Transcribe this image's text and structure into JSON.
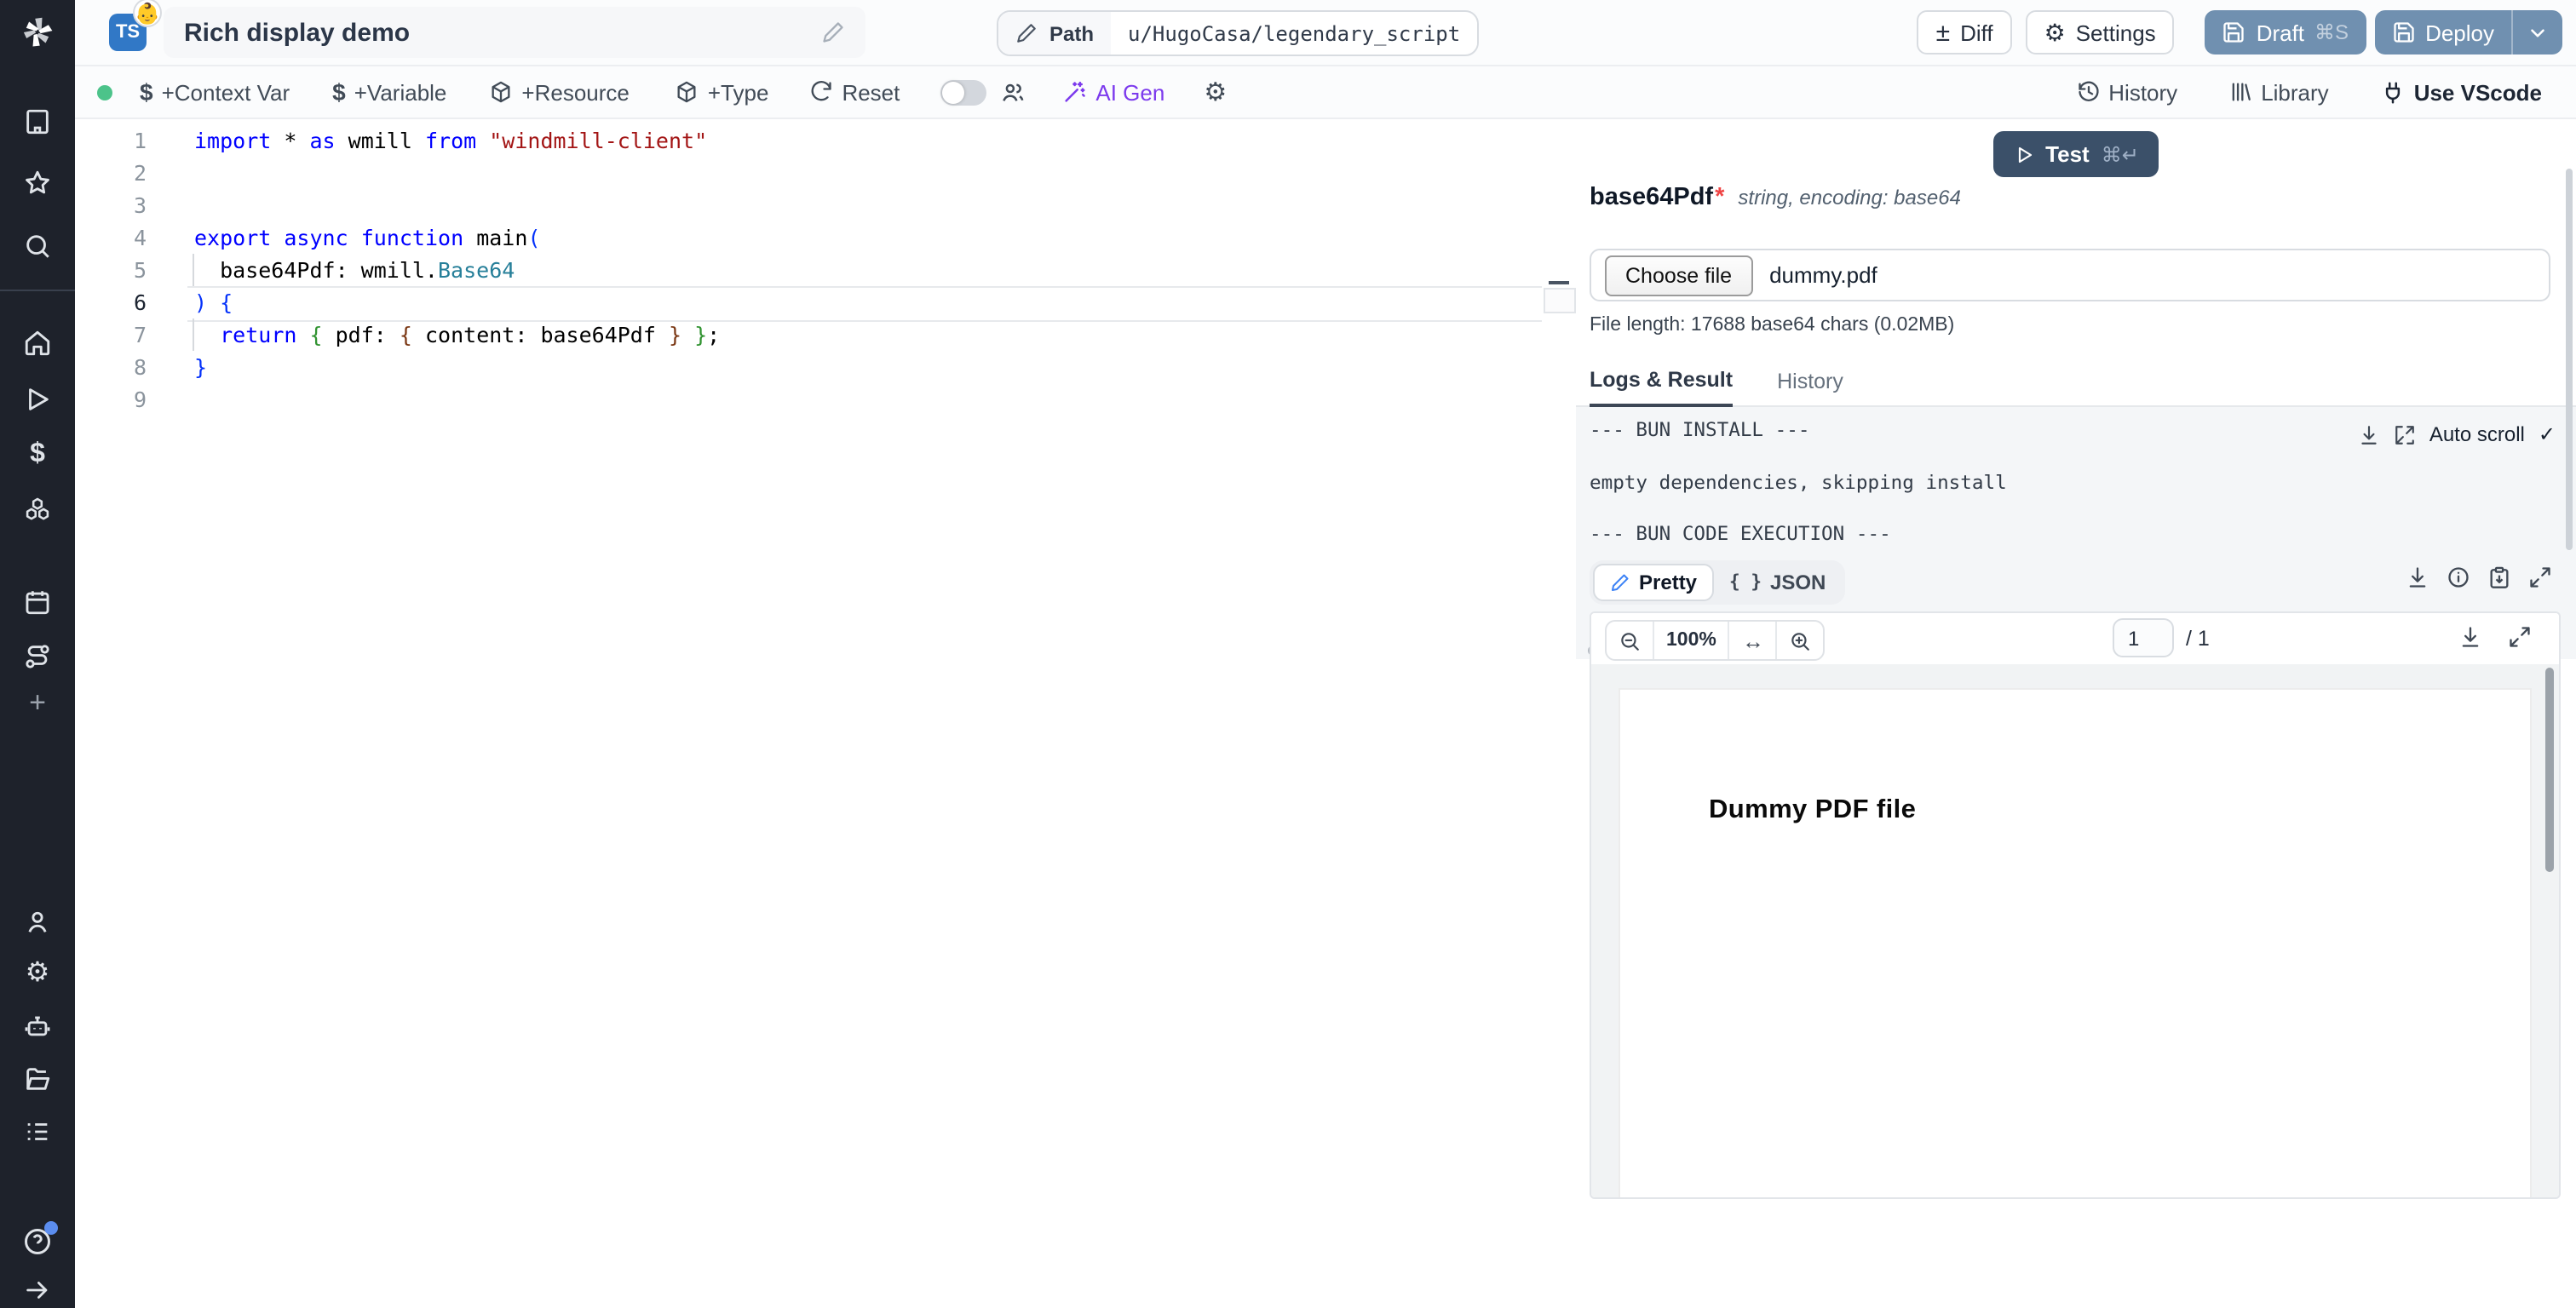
{
  "colors": {
    "sidebar_bg": "#1e222b",
    "draft_deploy_blue": "#7090b0",
    "test_navy": "#3b5069",
    "ai_gen_purple": "#7c3aed",
    "status_green": "#4cc38a",
    "ts_badge_blue": "#3178c6",
    "code_keyword": "#0000ff",
    "code_string": "#a31515",
    "code_type": "#267f99"
  },
  "sidebar": {
    "icons": [
      "windmill-logo",
      "building",
      "star",
      "search",
      "home",
      "play-runs",
      "dollar-variables",
      "boxes-resources",
      "calendar-schedules",
      "route-flows",
      "plus",
      "user",
      "settings-gear",
      "robot-workers",
      "folder-open",
      "audit-list",
      "help-circle",
      "arrow-right-expand"
    ],
    "dollar_glyph": "$",
    "plus_glyph": "+"
  },
  "header": {
    "badge": "TS",
    "badge_emoji": "👶",
    "title": "Rich display demo",
    "path_label": "Path",
    "path_value": "u/HugoCasa/legendary_script",
    "diff_glyph": "±",
    "diff": "Diff",
    "settings_glyph": "⚙",
    "settings": "Settings",
    "draft": "Draft",
    "draft_kbd": "⌘S",
    "deploy": "Deploy"
  },
  "toolbar": {
    "dollar": "$",
    "context_var": "+Context Var",
    "variable": "+Variable",
    "resource": "+Resource",
    "type": "+Type",
    "reset": "Reset",
    "ai_gen": "AI Gen",
    "gear_glyph": "⚙",
    "history": "History",
    "library": "Library",
    "vscode": "Use VScode"
  },
  "editor": {
    "current_line": 6,
    "lines": [
      {
        "n": 1,
        "tokens": [
          [
            "import",
            "kw"
          ],
          [
            " * ",
            ""
          ],
          [
            "as",
            "kw"
          ],
          [
            " wmill ",
            ""
          ],
          [
            "from",
            "kw"
          ],
          [
            " ",
            ""
          ],
          [
            "\"windmill-client\"",
            "str"
          ]
        ]
      },
      {
        "n": 2,
        "tokens": []
      },
      {
        "n": 3,
        "tokens": []
      },
      {
        "n": 4,
        "tokens": [
          [
            "export",
            "kw"
          ],
          [
            " ",
            ""
          ],
          [
            "async",
            "kw"
          ],
          [
            " ",
            ""
          ],
          [
            "function",
            "kw"
          ],
          [
            " main",
            ""
          ],
          [
            "(",
            "b1"
          ]
        ]
      },
      {
        "n": 5,
        "tokens": [
          [
            "  base64Pdf: wmill.",
            ""
          ],
          [
            "Base64",
            "type"
          ]
        ]
      },
      {
        "n": 6,
        "tokens": [
          [
            ") {",
            "b1"
          ]
        ]
      },
      {
        "n": 7,
        "tokens": [
          [
            "  ",
            ""
          ],
          [
            "return",
            "kw"
          ],
          [
            " ",
            ""
          ],
          [
            "{",
            "b2"
          ],
          [
            " pdf: ",
            ""
          ],
          [
            "{",
            "b3"
          ],
          [
            " content: base64Pdf ",
            ""
          ],
          [
            "}",
            "b3"
          ],
          [
            " ",
            ""
          ],
          [
            "}",
            "b2"
          ],
          [
            ";",
            ""
          ]
        ]
      },
      {
        "n": 8,
        "tokens": [
          [
            "}",
            "b1"
          ]
        ]
      },
      {
        "n": 9,
        "tokens": []
      }
    ]
  },
  "panel": {
    "test": {
      "label": "Test",
      "kbd": "⌘↵"
    },
    "param": {
      "name": "base64Pdf",
      "required": "*",
      "type": "string, encoding: base64"
    },
    "file": {
      "button": "Choose file",
      "name": "dummy.pdf",
      "info": "File length: 17688 base64 chars (0.02MB)"
    },
    "tabs": {
      "logs": "Logs & Result",
      "history": "History"
    },
    "logs_text": "--- BUN INSTALL ---\n\nempty dependencies, skipping install\n\n--- BUN CODE EXECUTION ---",
    "auto_scroll": "Auto scroll",
    "check": "✓",
    "result": {
      "pretty": "Pretty",
      "json": "JSON",
      "braces": "{ }"
    },
    "pdf": {
      "zoom": "100%",
      "fit": "↔",
      "page": "1",
      "of": "/ 1",
      "content": "Dummy PDF file"
    }
  }
}
